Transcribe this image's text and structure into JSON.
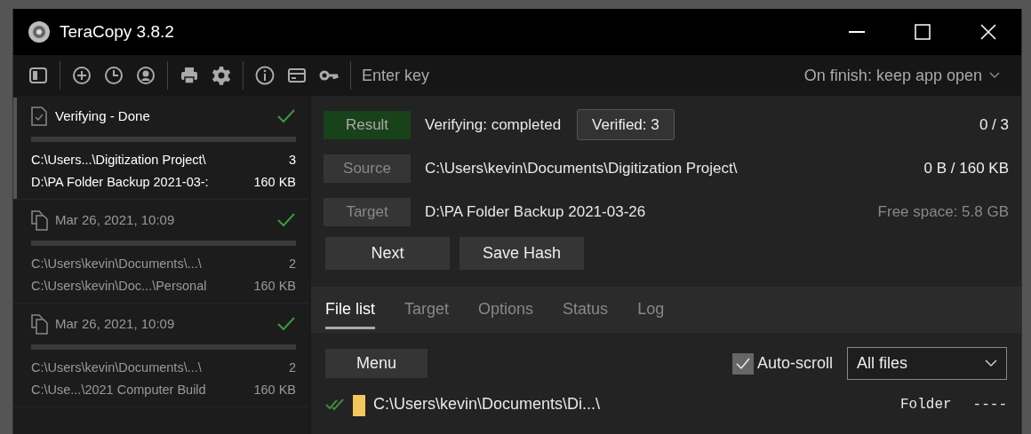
{
  "window": {
    "title": "TeraCopy 3.8.2"
  },
  "toolbar": {
    "key_placeholder": "Enter key",
    "on_finish": "On finish: keep app open"
  },
  "jobs": [
    {
      "kind": "verify",
      "title": "Verifying - Done",
      "done": true,
      "selected": true,
      "source": "C:\\Users...\\Digitization Project\\",
      "count": "3",
      "target": "D:\\PA Folder Backup 2021-03-:",
      "size": "160 KB"
    },
    {
      "kind": "copy",
      "title": "Mar 26, 2021, 10:09",
      "done": true,
      "selected": false,
      "source": "C:\\Users\\kevin\\Documents\\...\\",
      "count": "2",
      "target": "C:\\Users\\kevin\\Doc...\\Personal",
      "size": "160 KB"
    },
    {
      "kind": "copy",
      "title": "Mar 26, 2021, 10:09",
      "done": true,
      "selected": false,
      "source": "C:\\Users\\kevin\\Documents\\...\\",
      "count": "2",
      "target": "C:\\Use...\\2021 Computer Build",
      "size": "160 KB"
    }
  ],
  "summary": [
    {
      "label": "Result",
      "highlighted": true,
      "value": "Verifying: completed",
      "badge": "Verified: 3",
      "right": "0 / 3",
      "right_dim": false
    },
    {
      "label": "Source",
      "highlighted": false,
      "value": "C:\\Users\\kevin\\Documents\\Digitization Project\\",
      "right": "0 B / 160 KB",
      "right_dim": false
    },
    {
      "label": "Target",
      "highlighted": false,
      "value": "D:\\PA Folder Backup 2021-03-26",
      "right": "Free space: 5.8 GB",
      "right_dim": true
    }
  ],
  "buttons": [
    "Next",
    "Save Hash"
  ],
  "tabs": [
    {
      "label": "File list",
      "selected": true
    },
    {
      "label": "Target",
      "selected": false
    },
    {
      "label": "Options",
      "selected": false
    },
    {
      "label": "Status",
      "selected": false
    },
    {
      "label": "Log",
      "selected": false
    }
  ],
  "file_list": {
    "menu": "Menu",
    "auto_scroll": {
      "label": "Auto-scroll",
      "checked": true
    },
    "filter": "All files",
    "rows": [
      {
        "verified": true,
        "path": "C:\\Users\\kevin\\Documents\\Di...\\",
        "type": "Folder",
        "size": "----"
      }
    ]
  }
}
